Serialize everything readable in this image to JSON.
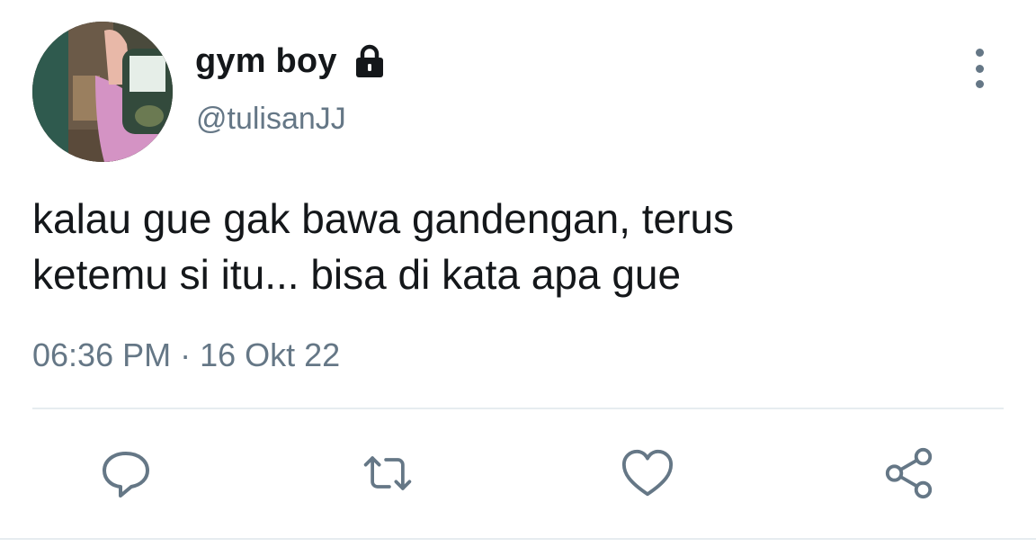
{
  "tweet": {
    "display_name": "gym boy",
    "username": "@tulisanJJ",
    "text_lines": [
      "kalau gue gak bawa gandengan, terus",
      "ketemu si itu... bisa di kata apa gue"
    ],
    "timestamp": "06:36 PM · 16 Okt 22"
  },
  "icons": {
    "lock": "lock-icon",
    "more": "more-vertical-icon",
    "reply": "reply-icon",
    "retweet": "retweet-icon",
    "like": "heart-icon",
    "share": "share-icon"
  },
  "colors": {
    "text": "#14171a",
    "secondary_text": "#657786",
    "divider": "#e6ecf0",
    "background": "#ffffff"
  }
}
